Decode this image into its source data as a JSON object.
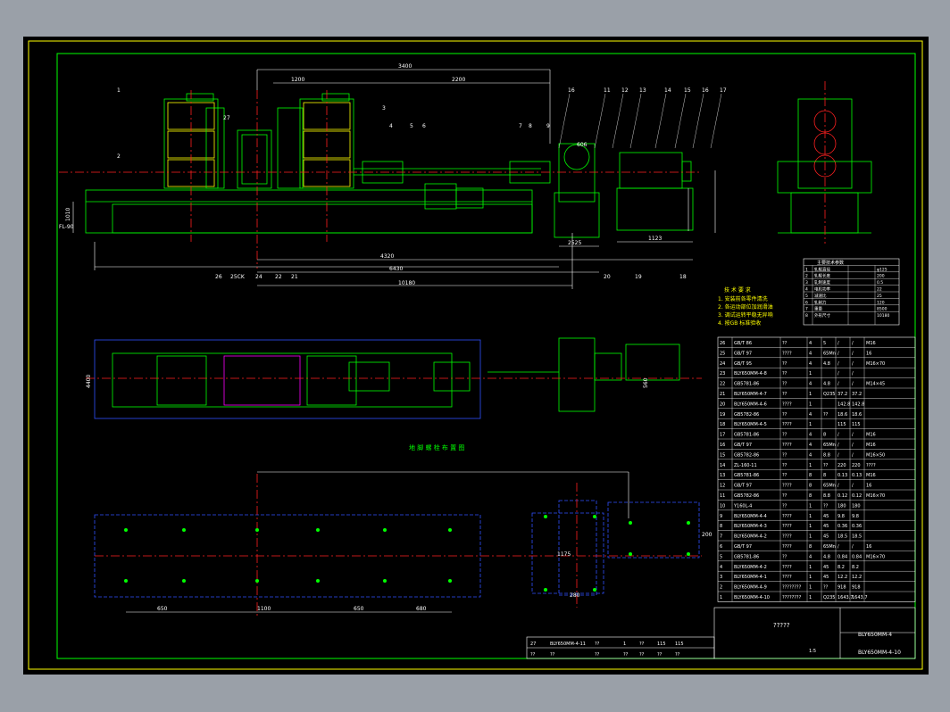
{
  "drawing": {
    "top_dims": {
      "overall": "3400",
      "span_left": "1200",
      "span_mid": "2200",
      "span_right": "1015"
    },
    "bottom_dims": {
      "d1": "4320",
      "d2": "6430",
      "d3": "10180",
      "d4": "1123",
      "d5": "2525",
      "d6": "2025",
      "d7": "606"
    },
    "side_labels": {
      "fl": "FL-90",
      "h1": "1010",
      "h2": "1010"
    },
    "plan_dims": {
      "w": "4400",
      "r": "560"
    },
    "foundation_title": "地 脚 螺 栓 布 置 图",
    "foundation_dims": [
      "650",
      "1100",
      "650",
      "680"
    ],
    "foundation_right": {
      "a": "1175",
      "b": "280",
      "c": "200"
    }
  },
  "balloons_top": [
    "16",
    "11",
    "12",
    "13",
    "14",
    "15",
    "16",
    "17"
  ],
  "balloons_left": [
    "1",
    "2",
    "27",
    "3",
    "4",
    "5",
    "6",
    "7",
    "8",
    "9"
  ],
  "balloons_bottom": [
    "26",
    "25CK",
    "24",
    "22",
    "21",
    "20",
    "19",
    "18"
  ],
  "tech_requirements": {
    "title": "技 术 要 求",
    "lines": [
      "1. 安装前各零件清洗",
      "2. 各运动部位加润滑油",
      "3. 调试运转平稳无异响",
      "4. 按GB 标准验收"
    ]
  },
  "parameter_table": {
    "header": "主要技术参数",
    "rows": [
      [
        "1",
        "轧辊直径",
        "",
        "φ125"
      ],
      [
        "2",
        "轧辊长度",
        "",
        "200"
      ],
      [
        "3",
        "轧制速度",
        "",
        "0.5"
      ],
      [
        "4",
        "电机功率",
        "",
        "22"
      ],
      [
        "5",
        "减速比",
        "",
        "25"
      ],
      [
        "6",
        "轧制力",
        "",
        "120"
      ],
      [
        "7",
        "重量",
        "",
        "8500"
      ],
      [
        "8",
        "外形尺寸",
        "",
        "10180"
      ]
    ]
  },
  "bom_rows": [
    [
      "26",
      "GB/T 86",
      "??",
      "4",
      "5",
      "/",
      "/",
      "M16"
    ],
    [
      "25",
      "GB/T 97",
      "????",
      "4",
      "65Mn",
      "/",
      "/",
      "16"
    ],
    [
      "24",
      "GB/T 95",
      "??",
      "4",
      "4.8",
      "/",
      "/",
      "M16×70"
    ],
    [
      "23",
      "BLY650MM-4-8",
      "??",
      "1",
      "",
      "/",
      "/",
      ""
    ],
    [
      "22",
      "GB5781-86",
      "??",
      "4",
      "4.8",
      "/",
      "/",
      "M14×45"
    ],
    [
      "21",
      "BLY650MM-4-7",
      "??",
      "1",
      "Q235",
      "37.2",
      "37.2",
      ""
    ],
    [
      "20",
      "BLY650MM-4-6",
      "????",
      "1",
      "",
      "142.8",
      "142.8",
      ""
    ],
    [
      "19",
      "GB5782-86",
      "??",
      "4",
      "??",
      "18.6",
      "18.6",
      ""
    ],
    [
      "18",
      "BLY650MM-4-5",
      "????",
      "1",
      "",
      "115",
      "115",
      ""
    ],
    [
      "17",
      "GB5781-86",
      "??",
      "4",
      "8",
      "/",
      "/",
      "M16"
    ],
    [
      "16",
      "GB/T 97",
      "????",
      "4",
      "65Mn",
      "/",
      "/",
      "M16"
    ],
    [
      "15",
      "GB5782-86",
      "??",
      "4",
      "8.8",
      "/",
      "/",
      "M16×50"
    ],
    [
      "14",
      "ZL-160-11",
      "??",
      "1",
      "??",
      "220",
      "220",
      "????"
    ],
    [
      "13",
      "GB5781-86",
      "??",
      "8",
      "8",
      "0.13",
      "0.13",
      "M16"
    ],
    [
      "12",
      "GB/T 97",
      "????",
      "8",
      "65Mn",
      "/",
      "/",
      "16"
    ],
    [
      "11",
      "GB5782-86",
      "??",
      "8",
      "8.8",
      "0.12",
      "0.12",
      "M16×70"
    ],
    [
      "10",
      "Y160L-4",
      "??",
      "1",
      "??",
      "180",
      "180",
      ""
    ],
    [
      "9",
      "BLY650MM-4-4",
      "????",
      "1",
      "45",
      "9.8",
      "9.8",
      ""
    ],
    [
      "8",
      "BLY650MM-4-3",
      "????",
      "1",
      "45",
      "0.36",
      "0.36",
      ""
    ],
    [
      "7",
      "BLY650MM-4-2",
      "????",
      "1",
      "45",
      "18.5",
      "18.5",
      ""
    ],
    [
      "6",
      "GB/T 97",
      "????",
      "8",
      "65Mn",
      "/",
      "/",
      "16"
    ],
    [
      "5",
      "GB5781-86",
      "??",
      "4",
      "4.8",
      "0.84",
      "0.84",
      "M16×70"
    ],
    [
      "4",
      "BLY650MM-4-2",
      "????",
      "1",
      "45",
      "8.2",
      "8.2",
      ""
    ],
    [
      "3",
      "BLY650MM-4-1",
      "????",
      "1",
      "45",
      "12.2",
      "12.2",
      ""
    ],
    [
      "2",
      "BLY650MM-4-9",
      "????????",
      "1",
      "??",
      "918",
      "918",
      ""
    ],
    [
      "1",
      "BLY650MM-4-10",
      "????????",
      "1",
      "Q235",
      "1643.7",
      "1643.7",
      ""
    ]
  ],
  "title_block": {
    "drawing_no": "BLY650MM-4",
    "assembly_no": "BLY650MM-4-10",
    "name": "?????",
    "scale": "1:5",
    "sheet": "1",
    "lower_row": [
      "27",
      "BLY650MM-4-11",
      "??",
      "1",
      "??",
      "115",
      "115"
    ],
    "lower_row2": [
      "??",
      "??",
      "??",
      "??",
      "??",
      "??",
      "??"
    ]
  },
  "colors": {
    "green": "#00ff00",
    "cyan": "#00ffff",
    "red": "#ff2020",
    "yellow": "#ffff00",
    "white": "#ffffff",
    "magenta": "#ff00ff",
    "blue": "#3050ff"
  }
}
